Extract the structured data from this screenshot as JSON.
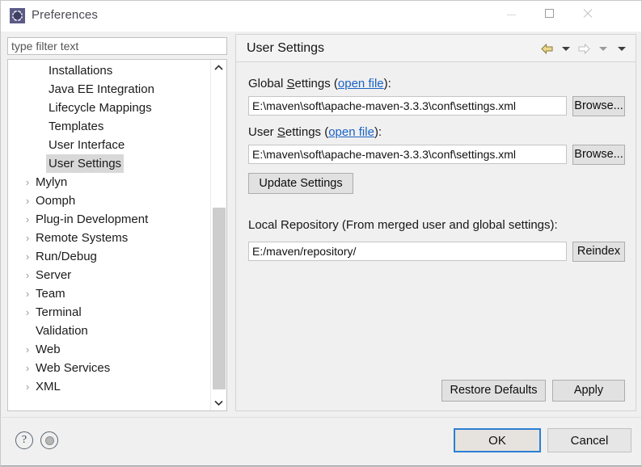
{
  "window": {
    "title": "Preferences",
    "icon": "preferences-gear-icon",
    "controls": {
      "minimize": "minimize-icon",
      "maximize": "maximize-icon",
      "close": "close-icon"
    }
  },
  "sidebar": {
    "filter": {
      "placeholder": "type filter text",
      "value": ""
    },
    "scroll": {
      "up_icon": "chevron-up-icon",
      "down_icon": "chevron-down-icon"
    },
    "items": [
      {
        "label": "Installations",
        "level": "child",
        "expandable": false,
        "selected": false
      },
      {
        "label": "Java EE Integration",
        "level": "child",
        "expandable": false,
        "selected": false
      },
      {
        "label": "Lifecycle Mappings",
        "level": "child",
        "expandable": false,
        "selected": false
      },
      {
        "label": "Templates",
        "level": "child",
        "expandable": false,
        "selected": false
      },
      {
        "label": "User Interface",
        "level": "child",
        "expandable": false,
        "selected": false
      },
      {
        "label": "User Settings",
        "level": "child",
        "expandable": false,
        "selected": true
      },
      {
        "label": "Mylyn",
        "level": "top",
        "expandable": true,
        "selected": false
      },
      {
        "label": "Oomph",
        "level": "top",
        "expandable": true,
        "selected": false
      },
      {
        "label": "Plug-in Development",
        "level": "top",
        "expandable": true,
        "selected": false
      },
      {
        "label": "Remote Systems",
        "level": "top",
        "expandable": true,
        "selected": false
      },
      {
        "label": "Run/Debug",
        "level": "top",
        "expandable": true,
        "selected": false
      },
      {
        "label": "Server",
        "level": "top",
        "expandable": true,
        "selected": false
      },
      {
        "label": "Team",
        "level": "top",
        "expandable": true,
        "selected": false
      },
      {
        "label": "Terminal",
        "level": "top",
        "expandable": true,
        "selected": false
      },
      {
        "label": "Validation",
        "level": "top",
        "expandable": false,
        "selected": false
      },
      {
        "label": "Web",
        "level": "top",
        "expandable": true,
        "selected": false
      },
      {
        "label": "Web Services",
        "level": "top",
        "expandable": true,
        "selected": false
      },
      {
        "label": "XML",
        "level": "top",
        "expandable": true,
        "selected": false
      }
    ],
    "chevron_glyph": "›"
  },
  "page": {
    "title": "User Settings",
    "toolbar": {
      "back_icon": "back-arrow-icon",
      "back_menu_icon": "caret-down-icon",
      "forward_icon": "forward-arrow-icon",
      "forward_menu_icon": "caret-down-icon",
      "view_menu_icon": "caret-down-icon"
    },
    "global_settings": {
      "label_prefix": "Global ",
      "label_mnemonic": "S",
      "label_rest": "ettings (",
      "link": "open file",
      "label_suffix": "):",
      "value": "E:\\maven\\soft\\apache-maven-3.3.3\\conf\\settings.xml",
      "browse_label": "Browse..."
    },
    "user_settings": {
      "label_prefix": "User ",
      "label_mnemonic": "S",
      "label_rest": "ettings (",
      "link": "open file",
      "label_suffix": "):",
      "value": "E:\\maven\\soft\\apache-maven-3.3.3\\conf\\settings.xml",
      "browse_label": "Browse..."
    },
    "update_settings_label": "Update Settings",
    "local_repository": {
      "label": "Local Repository (From merged user and global settings):",
      "value": "E:/maven/repository/",
      "reindex_label": "Reindex"
    },
    "restore_defaults_label": "Restore Defaults",
    "apply_label": "Apply"
  },
  "footer": {
    "help_icon": "help-question-icon",
    "help_glyph": "?",
    "secondary_icon": "target-circle-icon",
    "ok_label": "OK",
    "cancel_label": "Cancel"
  },
  "colors": {
    "accent": "#2b7fd4",
    "link": "#1a62c4",
    "selection": "#d8d8d8",
    "panel": "#f0f0f0",
    "back_arrow": "#e8d07a"
  }
}
